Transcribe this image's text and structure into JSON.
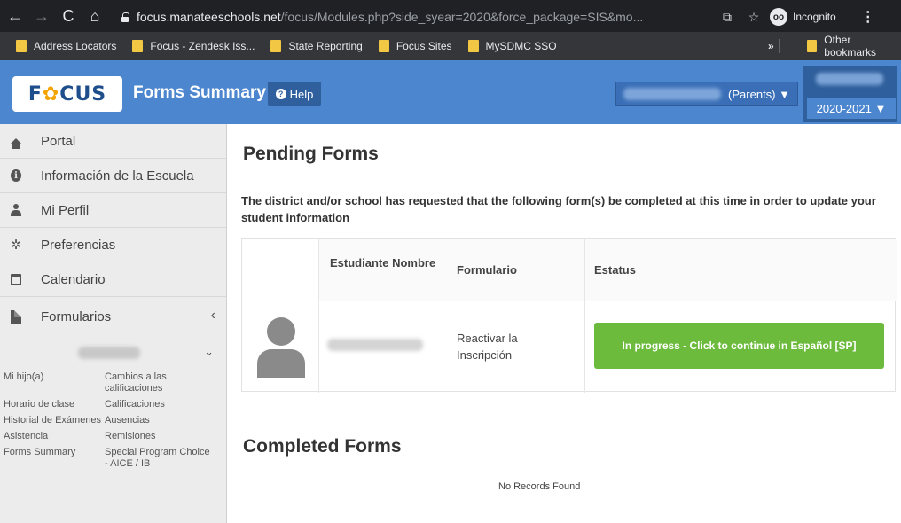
{
  "browser": {
    "url_host": "focus.manateeschools.net",
    "url_rest": "/focus/Modules.php?side_syear=2020&force_package=SIS&mo...",
    "incognito_label": "Incognito",
    "bookmarks": [
      "Address Locators",
      "Focus - Zendesk Iss...",
      "State Reporting",
      "Focus Sites",
      "MySDMC SSO"
    ],
    "more_glyph": "»",
    "other_bookmarks": "Other bookmarks"
  },
  "header": {
    "logo_text_1": "F",
    "logo_owl": "✿",
    "logo_text_2": "CUS",
    "title": "Forms Summary",
    "help_label": "Help",
    "parent_selector": "(Parents) ▼",
    "school_year": "2020-2021 ▼"
  },
  "sidebar": {
    "items": [
      {
        "label": "Portal",
        "icon": "home-icon"
      },
      {
        "label": "Información de la Escuela",
        "icon": "info-icon"
      },
      {
        "label": "Mi Perfil",
        "icon": "user-icon"
      },
      {
        "label": "Preferencias",
        "icon": "gear-icon"
      },
      {
        "label": "Calendario",
        "icon": "calendar-icon"
      }
    ],
    "forms_label": "Formularios",
    "forms_chevron": "‹",
    "student_chevron": "⌄",
    "sublinks": [
      [
        "Mi hijo(a)",
        "Cambios a las calificaciones"
      ],
      [
        "Horario de clase",
        "Calificaciones"
      ],
      [
        "Historial de Exámenes",
        "Ausencias"
      ],
      [
        "Asistencia",
        "Remisiones"
      ],
      [
        "Forms Summary",
        "Special Program Choice - AICE / IB"
      ]
    ]
  },
  "main": {
    "pending_title": "Pending Forms",
    "intro_text": "The district and/or school has requested that the following form(s) be completed at this time in order to update your student information",
    "table": {
      "headers": [
        "Estudiante Nombre",
        "Formulario",
        "Estatus"
      ],
      "row": {
        "form": "Reactivar la Inscripción",
        "status_button": "In progress - Click to continue in Español [SP]"
      }
    },
    "completed_title": "Completed Forms",
    "no_records": "No Records Found"
  },
  "colors": {
    "header_blue": "#4c86cf",
    "button_green": "#6cbb3c",
    "chrome_dark": "#202124"
  }
}
